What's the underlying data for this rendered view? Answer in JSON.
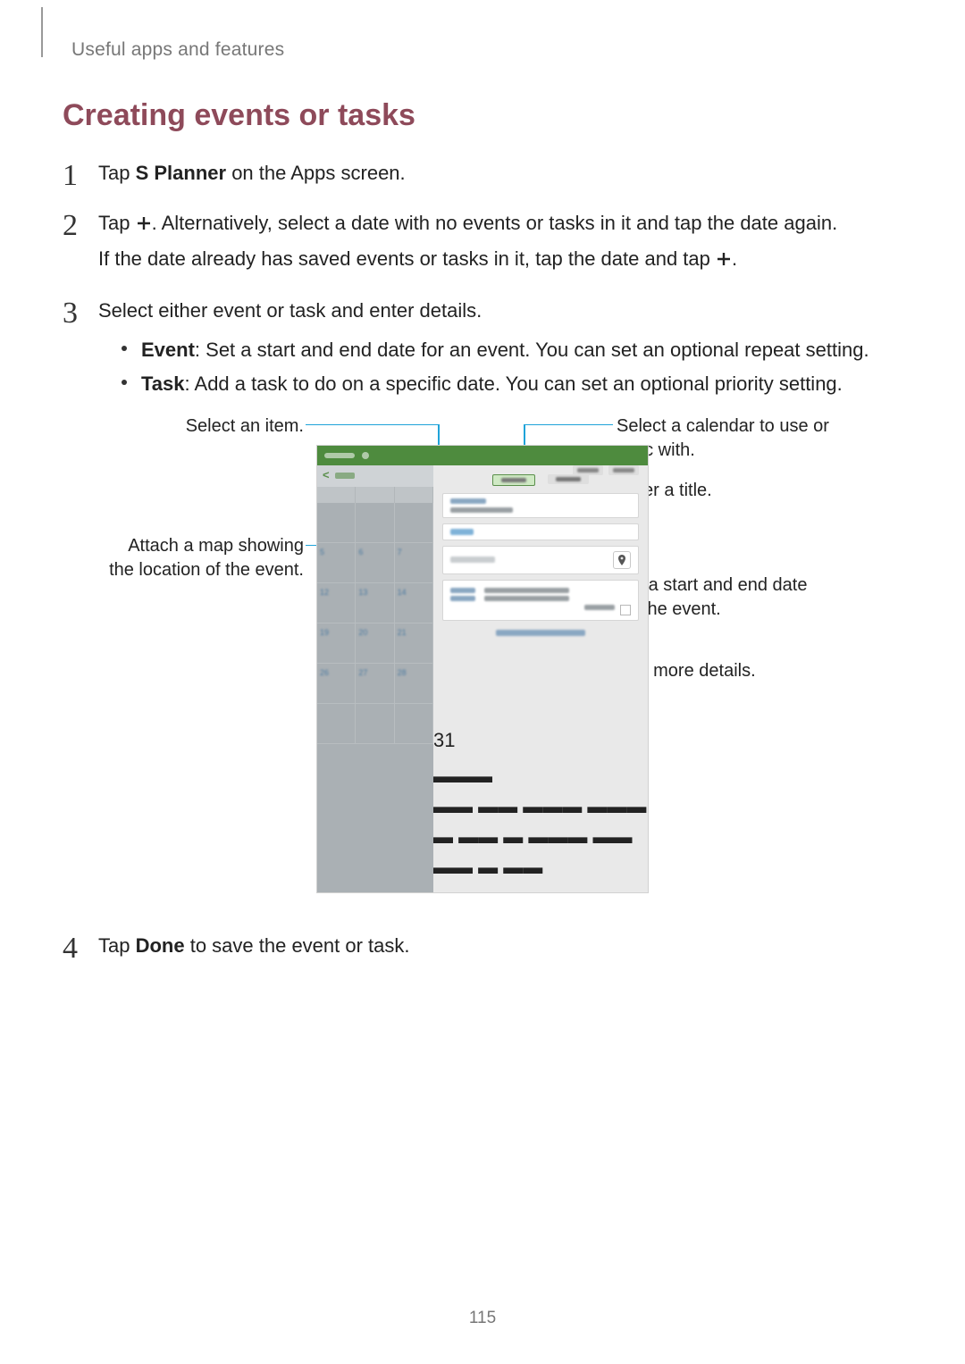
{
  "breadcrumb": "Useful apps and features",
  "section_title": "Creating events or tasks",
  "steps": {
    "s1": {
      "num": "1",
      "pre": "Tap ",
      "bold": "S Planner",
      "post": " on the Apps screen."
    },
    "s2": {
      "num": "2",
      "line1_pre": "Tap ",
      "line1_post": ". Alternatively, select a date with no events or tasks in it and tap the date again.",
      "line2_pre": "If the date already has saved events or tasks in it, tap the date and tap ",
      "line2_post": "."
    },
    "s3": {
      "num": "3",
      "intro": "Select either event or task and enter details.",
      "b1_bold": "Event",
      "b1_rest": ": Set a start and end date for an event. You can set an optional repeat setting.",
      "b2_bold": "Task",
      "b2_rest": ": Add a task to do on a specific date. You can set an optional priority setting."
    },
    "s4": {
      "num": "4",
      "pre": "Tap ",
      "bold": "Done",
      "post": " to save the event or task."
    }
  },
  "callouts": {
    "left1": "Select an item.",
    "left2": "Attach a map showing the location of the event.",
    "right1": "Select a calendar to use or sync with.",
    "right2": "Enter a title.",
    "right3": "Set a start and end date for the event.",
    "right4": "Add more details."
  },
  "mock": {
    "big_day": "31"
  },
  "page_number": "115"
}
